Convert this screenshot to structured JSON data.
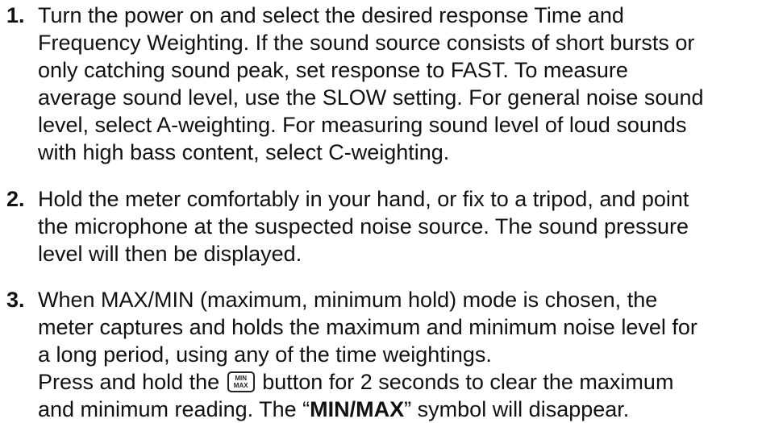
{
  "steps": [
    {
      "number": "1.",
      "lines": [
        "Turn the power on and select the desired response Time and",
        "Frequency Weighting. If the sound source consists of short bursts or",
        "only catching sound peak, set response to FAST. To measure",
        "average sound level, use the SLOW setting. For general noise sound",
        "level, select A-weighting. For measuring sound level of loud sounds",
        "with high bass content, select C-weighting."
      ]
    },
    {
      "number": "2.",
      "lines": [
        "Hold the meter comfortably in your hand, or fix to a tripod, and point",
        "the microphone at the suspected noise source. The sound pressure",
        "level will then be displayed."
      ]
    },
    {
      "number": "3.",
      "lines": [
        "When MAX/MIN (maximum, minimum hold) mode is chosen, the",
        "meter captures and holds the maximum and minimum noise level for",
        "a long period, using any of the time weightings."
      ],
      "press_line": {
        "before": "Press and hold the",
        "after": "button for 2 seconds to clear the maximum"
      },
      "last_line": {
        "before": "and minimum reading. The “",
        "bold": "MIN/MAX",
        "after": "” symbol will disappear."
      }
    }
  ],
  "minmax_button": {
    "top": "MIN",
    "bottom": "MAX",
    "icon": "min-max-button-icon"
  }
}
